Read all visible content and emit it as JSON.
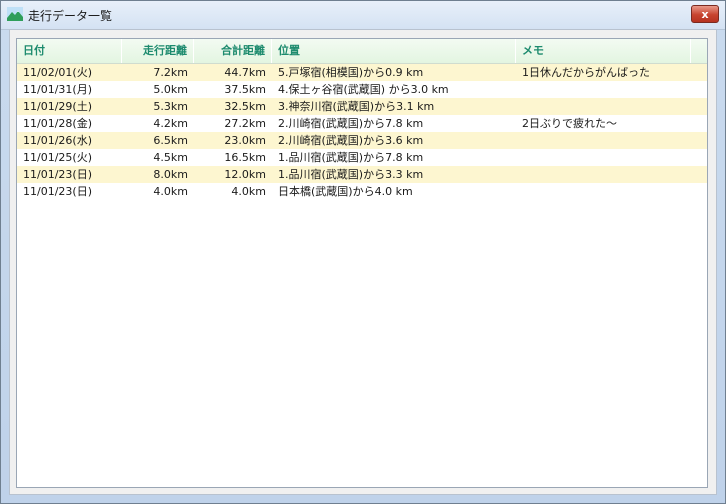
{
  "window": {
    "title": "走行データ一覧",
    "close_label": "x"
  },
  "table": {
    "headers": {
      "date": "日付",
      "distance": "走行距離",
      "total": "合計距離",
      "position": "位置",
      "memo": "メモ"
    },
    "rows": [
      {
        "date": "11/02/01(火)",
        "distance": "7.2km",
        "total": "44.7km",
        "position": "5.戸塚宿(相模国)から0.9 km",
        "memo": "1日休んだからがんばった"
      },
      {
        "date": "11/01/31(月)",
        "distance": "5.0km",
        "total": "37.5km",
        "position": "4.保土ヶ谷宿(武蔵国) から3.0 km",
        "memo": ""
      },
      {
        "date": "11/01/29(土)",
        "distance": "5.3km",
        "total": "32.5km",
        "position": "3.神奈川宿(武蔵国)から3.1 km",
        "memo": ""
      },
      {
        "date": "11/01/28(金)",
        "distance": "4.2km",
        "total": "27.2km",
        "position": "2.川崎宿(武蔵国)から7.8 km",
        "memo": "2日ぶりで疲れた〜"
      },
      {
        "date": "11/01/26(水)",
        "distance": "6.5km",
        "total": "23.0km",
        "position": "2.川崎宿(武蔵国)から3.6 km",
        "memo": ""
      },
      {
        "date": "11/01/25(火)",
        "distance": "4.5km",
        "total": "16.5km",
        "position": "1.品川宿(武蔵国)から7.8 km",
        "memo": ""
      },
      {
        "date": "11/01/23(日)",
        "distance": "8.0km",
        "total": "12.0km",
        "position": "1.品川宿(武蔵国)から3.3 km",
        "memo": ""
      },
      {
        "date": "11/01/23(日)",
        "distance": "4.0km",
        "total": "4.0km",
        "position": "日本橋(武蔵国)から4.0 km",
        "memo": ""
      }
    ]
  },
  "colors": {
    "header_text": "#1d8b6e",
    "row_alt": "#fdf6d0",
    "close_button": "#c7432e"
  }
}
